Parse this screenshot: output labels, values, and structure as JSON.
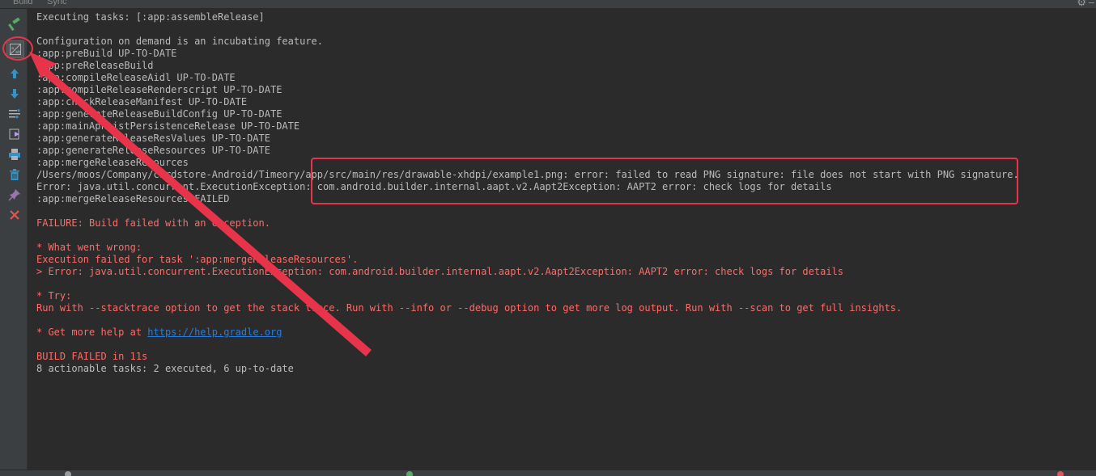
{
  "tabs": {
    "build": "Build",
    "sync": "Sync"
  },
  "toolbar_icons": [
    "hammer-icon",
    "toggle-view-icon",
    "arrow-up-icon",
    "arrow-down-icon",
    "filter-icon",
    "export-icon",
    "print-icon",
    "trash-icon",
    "pin-icon",
    "close-icon"
  ],
  "console": {
    "lines": [
      "Executing tasks: [:app:assembleRelease]",
      "",
      "Configuration on demand is an incubating feature.",
      ":app:preBuild UP-TO-DATE",
      ":app:preReleaseBuild",
      ":app:compileReleaseAidl UP-TO-DATE",
      ":app:compileReleaseRenderscript UP-TO-DATE",
      ":app:checkReleaseManifest UP-TO-DATE",
      ":app:generateReleaseBuildConfig UP-TO-DATE",
      ":app:mainApkListPersistenceRelease UP-TO-DATE",
      ":app:generateReleaseResValues UP-TO-DATE",
      ":app:generateReleaseResources UP-TO-DATE",
      ":app:mergeReleaseResources",
      "/Users/moos/Company/cardstore-Android/Timeory/app/src/main/res/drawable-xhdpi/example1.png: error: failed to read PNG signature: file does not start with PNG signature.",
      "Error: java.util.concurrent.ExecutionException: com.android.builder.internal.aapt.v2.Aapt2Exception: AAPT2 error: check logs for details",
      ":app:mergeReleaseResources FAILED",
      "",
      "FAILURE: Build failed with an exception.",
      "",
      "* What went wrong:",
      "Execution failed for task ':app:mergeReleaseResources'.",
      "> Error: java.util.concurrent.ExecutionException: com.android.builder.internal.aapt.v2.Aapt2Exception: AAPT2 error: check logs for details",
      "",
      "* Try:",
      "Run with --stacktrace option to get the stack trace. Run with --info or --debug option to get more log output. Run with --scan to get full insights.",
      "",
      "* Get more help at ",
      "",
      "BUILD FAILED in 11s",
      "8 actionable tasks: 2 executed, 6 up-to-date"
    ],
    "help_link": "https://help.gradle.org"
  },
  "colors": {
    "background": "#2b2b2b",
    "normal_text": "#bbbbbb",
    "error_text": "#ff6b68",
    "link": "#287bde",
    "annotation": "#e8344a"
  }
}
